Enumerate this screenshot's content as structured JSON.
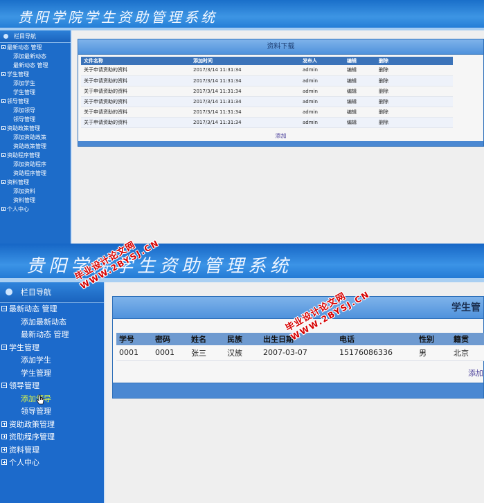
{
  "app": {
    "title": "贵阳学院学生资助管理系统"
  },
  "sidebar": {
    "header": "栏目导航",
    "items": [
      {
        "label": "最新动态 管理",
        "level": 1,
        "toggle": "minus"
      },
      {
        "label": "添加最新动态",
        "level": 2
      },
      {
        "label": "最新动态 管理",
        "level": 2
      },
      {
        "label": "学生管理",
        "level": 1,
        "toggle": "minus"
      },
      {
        "label": "添加学生",
        "level": 2
      },
      {
        "label": "学生管理",
        "level": 2
      },
      {
        "label": "领导管理",
        "level": 1,
        "toggle": "minus"
      },
      {
        "label": "添加领导",
        "level": 2
      },
      {
        "label": "领导管理",
        "level": 2
      },
      {
        "label": "资助政策管理",
        "level": 1,
        "toggle": "minus"
      },
      {
        "label": "添加资助政策",
        "level": 2
      },
      {
        "label": "资助政策管理",
        "level": 2
      },
      {
        "label": "资助程序管理",
        "level": 1,
        "toggle": "minus"
      },
      {
        "label": "添加资助程序",
        "level": 2
      },
      {
        "label": "资助程序管理",
        "level": 2
      },
      {
        "label": "资料管理",
        "level": 1,
        "toggle": "minus"
      },
      {
        "label": "添加资料",
        "level": 2
      },
      {
        "label": "资料管理",
        "level": 2
      },
      {
        "label": "个人中心",
        "level": 1,
        "toggle": "plus"
      }
    ]
  },
  "sidebar2": {
    "header": "栏目导航",
    "items": [
      {
        "label": "最新动态 管理",
        "level": 1,
        "toggle": "minus"
      },
      {
        "label": "添加最新动态",
        "level": 2
      },
      {
        "label": "最新动态 管理",
        "level": 2
      },
      {
        "label": "学生管理",
        "level": 1,
        "toggle": "minus"
      },
      {
        "label": "添加学生",
        "level": 2
      },
      {
        "label": "学生管理",
        "level": 2
      },
      {
        "label": "领导管理",
        "level": 1,
        "toggle": "minus"
      },
      {
        "label": "添加领导",
        "level": 2,
        "active": true
      },
      {
        "label": "领导管理",
        "level": 2
      },
      {
        "label": "资助政策管理",
        "level": 1,
        "toggle": "plus"
      },
      {
        "label": "资助程序管理",
        "level": 1,
        "toggle": "plus"
      },
      {
        "label": "资料管理",
        "level": 1,
        "toggle": "plus"
      },
      {
        "label": "个人中心",
        "level": 1,
        "toggle": "plus"
      }
    ]
  },
  "download_panel": {
    "title": "资料下载",
    "columns": [
      "文件名称",
      "添加时间",
      "发布人",
      "编辑",
      "删除"
    ],
    "rows": [
      [
        "关于申请资助的资料",
        "2017/3/14 11:31:34",
        "admin",
        "编辑",
        "删除"
      ],
      [
        "关于申请资助的资料",
        "2017/3/14 11:31:34",
        "admin",
        "编辑",
        "删除"
      ],
      [
        "关于申请资助的资料",
        "2017/3/14 11:31:34",
        "admin",
        "编辑",
        "删除"
      ],
      [
        "关于申请资助的资料",
        "2017/3/14 11:31:34",
        "admin",
        "编辑",
        "删除"
      ],
      [
        "关于申请资助的资料",
        "2017/3/14 11:31:34",
        "admin",
        "编辑",
        "删除"
      ],
      [
        "关于申请资助的资料",
        "2017/3/14 11:31:34",
        "admin",
        "编辑",
        "删除"
      ]
    ],
    "add_label": "添加"
  },
  "student_panel": {
    "title": "学生管",
    "columns": [
      "学号",
      "密码",
      "姓名",
      "民族",
      "出生日期",
      "电话",
      "性别",
      "籍贯"
    ],
    "rows": [
      [
        "0001",
        "0001",
        "张三",
        "汉族",
        "2007-03-07",
        "15176086336",
        "男",
        "北京"
      ]
    ],
    "add_label": "添加"
  },
  "watermark": {
    "site_name": "毕业设计论文网",
    "url": "WWW.2BYSJ.CN"
  },
  "colors": {
    "banner": "#2a82da",
    "sidebar": "#1c6acb",
    "table_header": "#3b73b9",
    "active_nav": "#d8f24a",
    "watermark": "#d60000"
  }
}
